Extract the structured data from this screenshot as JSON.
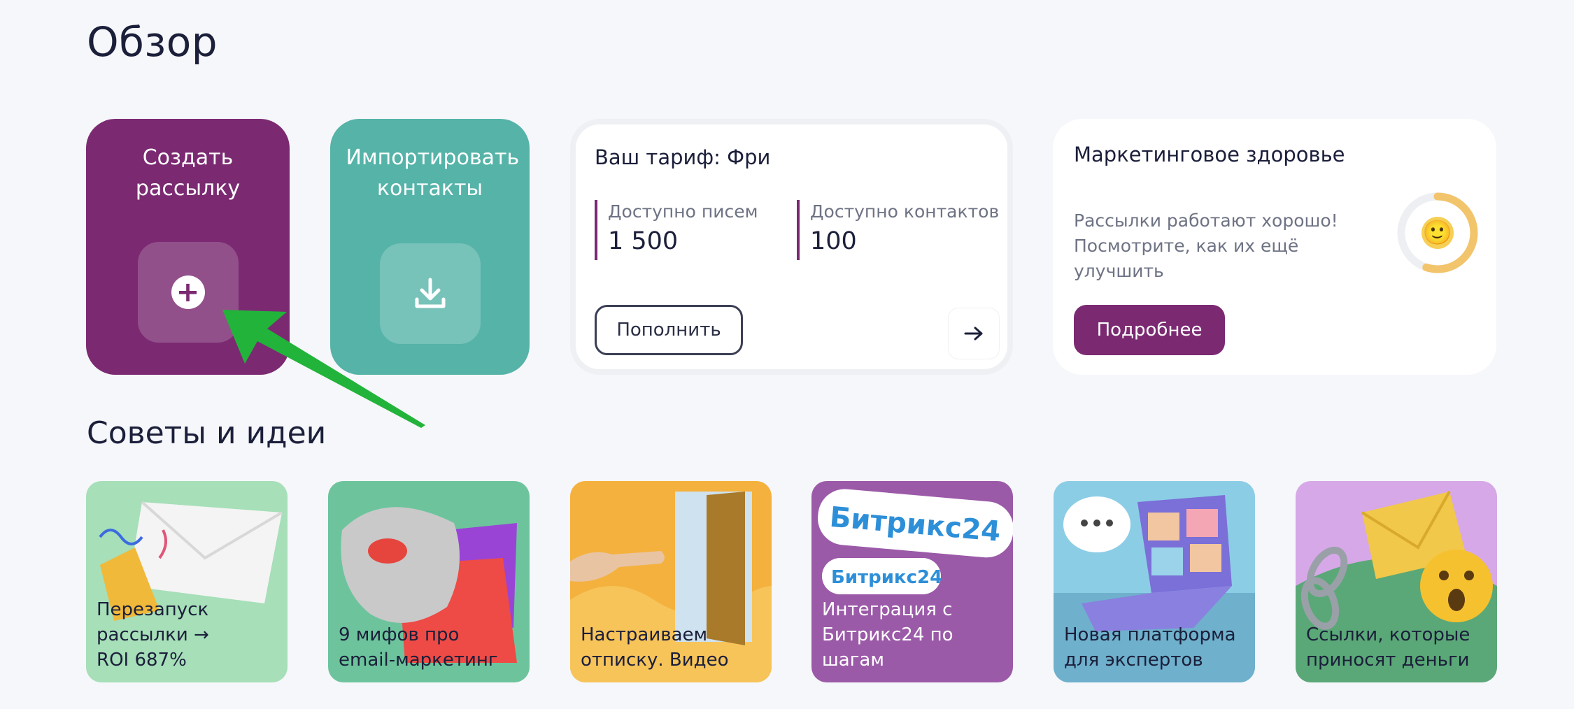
{
  "page": {
    "title": "Обзор"
  },
  "actions": {
    "create_label": "Создать рассылку",
    "import_label": "Импортировать контакты"
  },
  "tariff": {
    "title": "Ваш тариф: Фри",
    "emails_label": "Доступно писем",
    "emails_value": "1 500",
    "contacts_label": "Доступно контактов",
    "contacts_value": "100",
    "topup_label": "Пополнить"
  },
  "health": {
    "title": "Маркетинговое здоровье",
    "line1": "Рассылки работают хорошо!",
    "line2": "Посмотрите, как их ещё улучшить",
    "score_fraction": 0.55,
    "more_label": "Подробнее"
  },
  "tips": {
    "heading": "Советы и идеи",
    "items": [
      {
        "label": "Перезапуск рассылки → ROI 687%",
        "bg": "#a6dfb8"
      },
      {
        "label": "9 мифов про email-маркетинг",
        "bg": "#6dc49c"
      },
      {
        "label": "Настраиваем отписку. Видео",
        "bg": "#f4b13d"
      },
      {
        "label": "Интеграция с Битрикс24 по шагам",
        "bg": "#9b5aa8",
        "brand": "Битрикс24"
      },
      {
        "label": "Новая платформа для экспертов",
        "bg": "#8ccde6"
      },
      {
        "label": "Ссылки, которые приносят деньги",
        "bg": "#5aa877"
      }
    ]
  },
  "colors": {
    "accent": "#7b2a72",
    "teal": "#55b3a8",
    "annotation": "#22b33a"
  }
}
